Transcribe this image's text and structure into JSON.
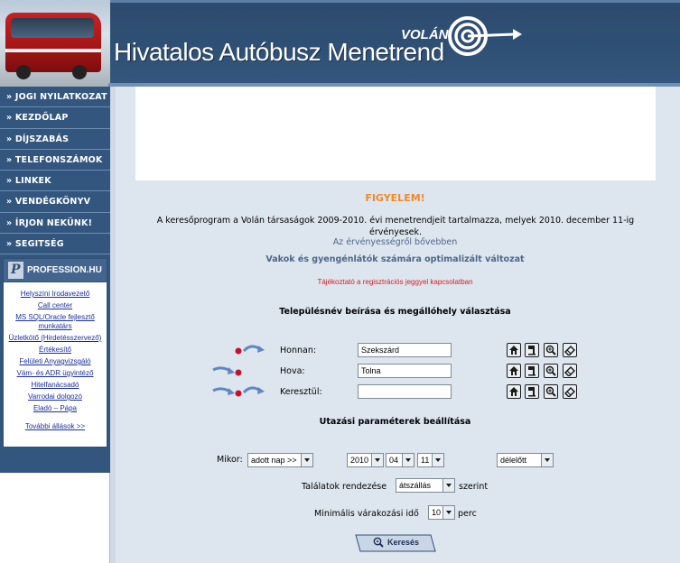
{
  "header": {
    "site_title": "Hivatalos Autóbusz Menetrend",
    "brand": "VOLÁN"
  },
  "sidebar": {
    "items": [
      {
        "label": "» JOGI NYILATKOZAT"
      },
      {
        "label": "» KEZDŐLAP"
      },
      {
        "label": "» DÍJSZABÁS"
      },
      {
        "label": "» TELEFONSZÁMOK"
      },
      {
        "label": "» LINKEK"
      },
      {
        "label": "» VENDÉGKÖNYV"
      },
      {
        "label": "» ÍRJON NEKÜNK!"
      },
      {
        "label": "» SEGITSÉG"
      }
    ],
    "profession": {
      "logo": "PROFESSION.HU",
      "jobs": [
        "Helyszíni Irodavezető",
        "Call center",
        "MS SQL/Oracle fejlesztő munkatárs",
        "Üzletkötő (Hirdetésszervező)",
        "Értékesítő",
        "Felületi Anyagvizsgáló",
        "Vám- és ADR ügyintéző",
        "Hitelfanácsadó",
        "Varrodai dolgozó",
        "Eladó – Pápa"
      ],
      "more": "További állások >>"
    }
  },
  "main": {
    "warning": "FIGYELEM!",
    "description": "A keresőprogram a Volán társaságok 2009-2010. évi menetrendjeit tartalmazza, melyek 2010. december 11-ig érvényesek.",
    "validity_link": "Az érvényességről bővebben",
    "accessible_link": "Vakok és gyengénlátók számára optimalizált változat",
    "info_link": "Tájékoztató a regisztrációs jeggyel kapcsolatban",
    "section_places": "Településnév beírása és megállóhely választása",
    "route": [
      {
        "label": "Honnan:",
        "value": ""
      },
      {
        "label": "Hova:",
        "value": ""
      },
      {
        "label": "Keresztül:",
        "value": ""
      }
    ],
    "route_values": [
      "Szekszárd",
      "Tolna",
      ""
    ],
    "section_params": "Utazási paraméterek beállítása",
    "when_label": "Mikor:",
    "when_select": "adott nap >>",
    "year": "2010",
    "month": "04",
    "day": "11",
    "daypart": "délelőtt",
    "sort_label": "Találatok rendezése",
    "sort_select": "átszállás",
    "sort_suffix": "szerint",
    "wait_label": "Minimális várakozási idő",
    "wait_value": "10",
    "wait_unit": "perc",
    "search_button": "Keresés"
  },
  "colors": {
    "header_bg": "#2f5075",
    "sidebar_bg": "#33567e",
    "main_bg": "#dde6ef",
    "warning": "#f08a24",
    "info_red": "#d41e1e",
    "link_blue": "#4c6787",
    "route_dot": "#c8102e",
    "route_arrow": "#5f87c0"
  },
  "icons": {
    "route_tools": [
      "home-icon",
      "bus-stop-icon",
      "zoom-icon",
      "eraser-icon"
    ]
  }
}
